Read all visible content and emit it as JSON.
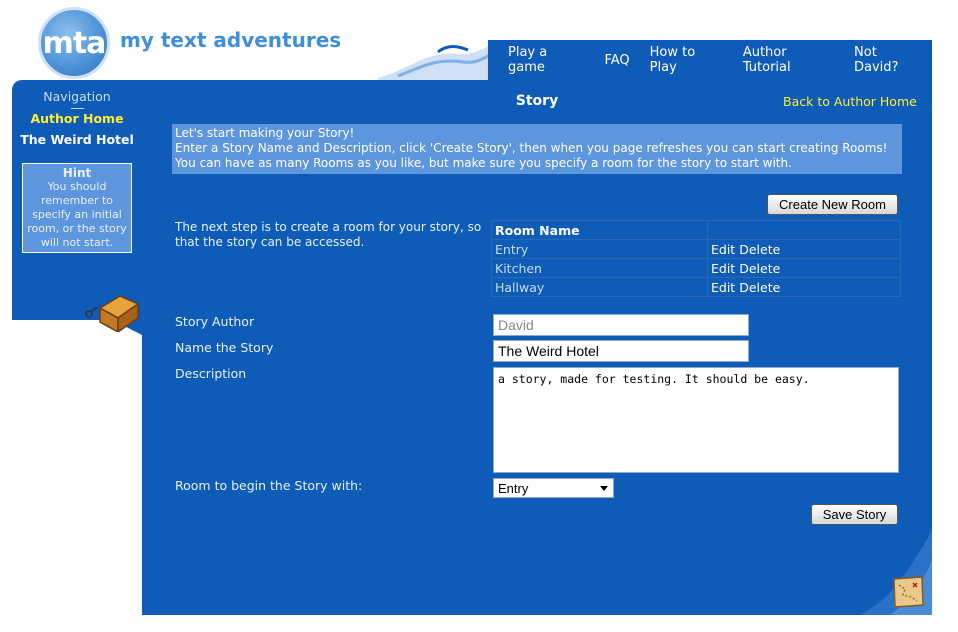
{
  "logo": {
    "badge": "mta",
    "wordmark": "my text adventures"
  },
  "top_nav": {
    "items": [
      "Play a game",
      "FAQ",
      "How to Play",
      "Author Tutorial",
      "Not David?"
    ]
  },
  "sidebar": {
    "title": "Navigation",
    "author_home": "Author Home",
    "story_name": "The Weird Hotel",
    "hint": {
      "title": "Hint",
      "text": "You should remember to specify an initial room, or the story will not start."
    }
  },
  "page": {
    "heading": "Story",
    "back_link": "Back to Author Home",
    "info_lines": [
      "Let's start making your Story!",
      "Enter a Story Name and Description, click 'Create Story', then when you page refreshes you can start creating Rooms!",
      "You can have as many Rooms as you like, but make sure you specify a room for the story to start with."
    ],
    "create_room_label": "Create New Room",
    "next_step_text": "The next step is to create a room for your story, so that the story can be accessed.",
    "rooms_table": {
      "header": "Room Name",
      "edit_label": "Edit",
      "delete_label": "Delete",
      "rows": [
        "Entry",
        "Kitchen",
        "Hallway"
      ]
    },
    "form": {
      "author_label": "Story Author",
      "author_placeholder": "David",
      "name_label": "Name the Story",
      "name_value": "The Weird Hotel",
      "description_label": "Description",
      "description_value": "a story, made for testing. It should be easy.",
      "start_room_label": "Room to begin the Story with:",
      "start_room_value": "Entry",
      "save_label": "Save Story"
    }
  },
  "colors": {
    "panel_blue": "#0f5bb8",
    "box_blue": "#5d96dc",
    "link_yellow": "#ffee33"
  }
}
